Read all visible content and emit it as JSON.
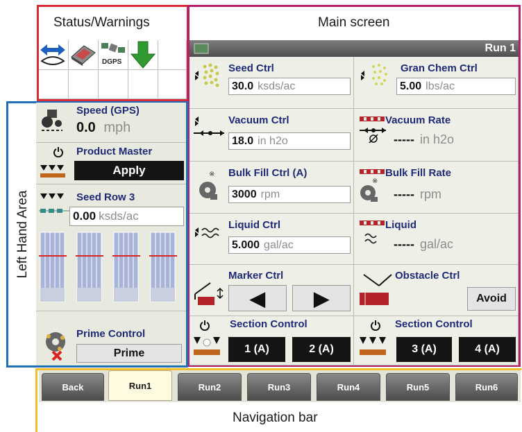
{
  "callouts": {
    "status_warnings": "Status/Warnings",
    "main_screen": "Main screen",
    "left_hand_area": "Left Hand Area",
    "navigation_bar": "Navigation bar"
  },
  "status": {
    "dgps_label": "DGPS"
  },
  "left": {
    "speed_label": "Speed (GPS)",
    "speed_value": "0.0",
    "speed_unit": "mph",
    "product_master_label": "Product Master",
    "product_master_button": "Apply",
    "seed_row_label": "Seed Row 3",
    "seed_row_value": "0.00",
    "seed_row_unit": "ksds/ac",
    "prime_label": "Prime Control",
    "prime_button": "Prime"
  },
  "main": {
    "header_title": "Run 1",
    "cells": {
      "seed_ctrl": {
        "label": "Seed Ctrl",
        "value": "30.0",
        "unit": "ksds/ac"
      },
      "gran_chem_ctrl": {
        "label": "Gran Chem Ctrl",
        "value": "5.00",
        "unit": "lbs/ac"
      },
      "vacuum_ctrl": {
        "label": "Vacuum Ctrl",
        "value": "18.0",
        "unit": "in h2o"
      },
      "vacuum_rate": {
        "label": "Vacuum Rate",
        "value": "-----",
        "unit": "in h2o"
      },
      "bulk_fill_ctrl": {
        "label": "Bulk Fill Ctrl (A)",
        "value": "3000",
        "unit": "rpm"
      },
      "bulk_fill_rate": {
        "label": "Bulk Fill Rate",
        "value": "-----",
        "unit": "rpm"
      },
      "liquid_ctrl": {
        "label": "Liquid Ctrl",
        "value": "5.000",
        "unit": "gal/ac"
      },
      "liquid": {
        "label": "Liquid",
        "value": "-----",
        "unit": "gal/ac"
      },
      "marker_ctrl": {
        "label": "Marker Ctrl",
        "left_arrow": "◀",
        "right_arrow": "▶"
      },
      "obstacle_ctrl": {
        "label": "Obstacle Ctrl",
        "button": "Avoid"
      },
      "section_control_1": {
        "label": "Section Control",
        "btn1": "1 (A)",
        "btn2": "2 (A)"
      },
      "section_control_2": {
        "label": "Section Control",
        "btn1": "3 (A)",
        "btn2": "4 (A)"
      }
    }
  },
  "nav": {
    "tabs": [
      "Back",
      "Run1",
      "Run2",
      "Run3",
      "Run4",
      "Run5",
      "Run6"
    ],
    "active": "Run1"
  },
  "colors": {
    "status_frame": "#d92b35",
    "main_frame": "#b5206a",
    "left_frame": "#1e6fb7",
    "nav_frame": "#f2bf2a",
    "label_blue": "#1e2a78"
  }
}
